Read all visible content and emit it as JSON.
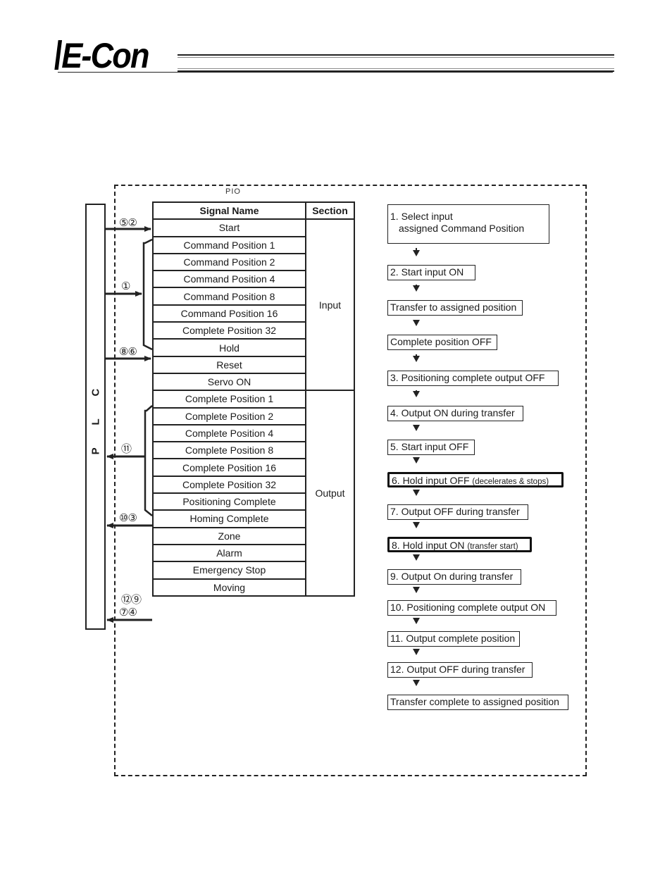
{
  "header": {
    "logo_text": "E-Con"
  },
  "diagram": {
    "frame_label": "PIO",
    "plc_label": "P L C",
    "table": {
      "columns": [
        "Signal Name",
        "Section"
      ],
      "rows": [
        {
          "name": "Start"
        },
        {
          "name": "Command Position 1"
        },
        {
          "name": "Command Position 2"
        },
        {
          "name": "Command Position 4"
        },
        {
          "name": "Command Position 8"
        },
        {
          "name": "Command Position 16"
        },
        {
          "name": "Complete Position 32"
        },
        {
          "name": "Hold"
        },
        {
          "name": "Reset"
        },
        {
          "name": "Servo ON"
        },
        {
          "name": "Complete Position 1"
        },
        {
          "name": "Complete Position 2"
        },
        {
          "name": "Complete Position 4"
        },
        {
          "name": "Complete Position 8"
        },
        {
          "name": "Complete Position 16"
        },
        {
          "name": "Complete Position 32"
        },
        {
          "name": "Positioning Complete"
        },
        {
          "name": "Homing Complete"
        },
        {
          "name": "Zone"
        },
        {
          "name": "Alarm"
        },
        {
          "name": "Emergency Stop"
        },
        {
          "name": "Moving"
        }
      ],
      "sections": [
        {
          "label": "Input",
          "rows": 10
        },
        {
          "label": "Output",
          "rows": 12
        }
      ]
    },
    "signal_arrows": [
      {
        "labels": "⑤②",
        "direction": "to-pio",
        "target": "Start"
      },
      {
        "labels": "①",
        "direction": "to-pio",
        "target": "Command Position 1-32"
      },
      {
        "labels": "⑧⑥",
        "direction": "to-pio",
        "target": "Hold"
      },
      {
        "labels": "⑪",
        "direction": "to-plc",
        "target": "Complete Position 1-32"
      },
      {
        "labels": "⑩③",
        "direction": "to-plc",
        "target": "Positioning Complete"
      },
      {
        "labels": "⑫⑨",
        "direction": "to-plc",
        "target": "Moving"
      },
      {
        "labels": "⑦④",
        "direction": "to-plc",
        "target": "Moving"
      }
    ],
    "flow_steps": [
      {
        "text": "1. Select input",
        "text2": "assigned Command Position",
        "emphasis": false
      },
      {
        "text": "2. Start input ON",
        "emphasis": false
      },
      {
        "text": "Transfer to assigned position",
        "emphasis": false
      },
      {
        "text": "Complete position OFF",
        "emphasis": false
      },
      {
        "text": "3. Positioning complete output OFF",
        "emphasis": false
      },
      {
        "text": "4. Output ON during transfer",
        "emphasis": false
      },
      {
        "text": "5. Start input OFF",
        "emphasis": false
      },
      {
        "text": "6. Hold input OFF ",
        "note": "(decelerates & stops)",
        "emphasis": true
      },
      {
        "text": "7. Output OFF during transfer",
        "emphasis": false
      },
      {
        "text": "8. Hold input ON ",
        "note": "(transfer start)",
        "emphasis": true
      },
      {
        "text": "9. Output On during transfer",
        "emphasis": false
      },
      {
        "text": "10. Positioning complete output ON",
        "emphasis": false
      },
      {
        "text": "11. Output complete position",
        "emphasis": false
      },
      {
        "text": "12. Output OFF during transfer",
        "emphasis": false
      },
      {
        "text": "Transfer complete to assigned position",
        "emphasis": false
      }
    ]
  }
}
